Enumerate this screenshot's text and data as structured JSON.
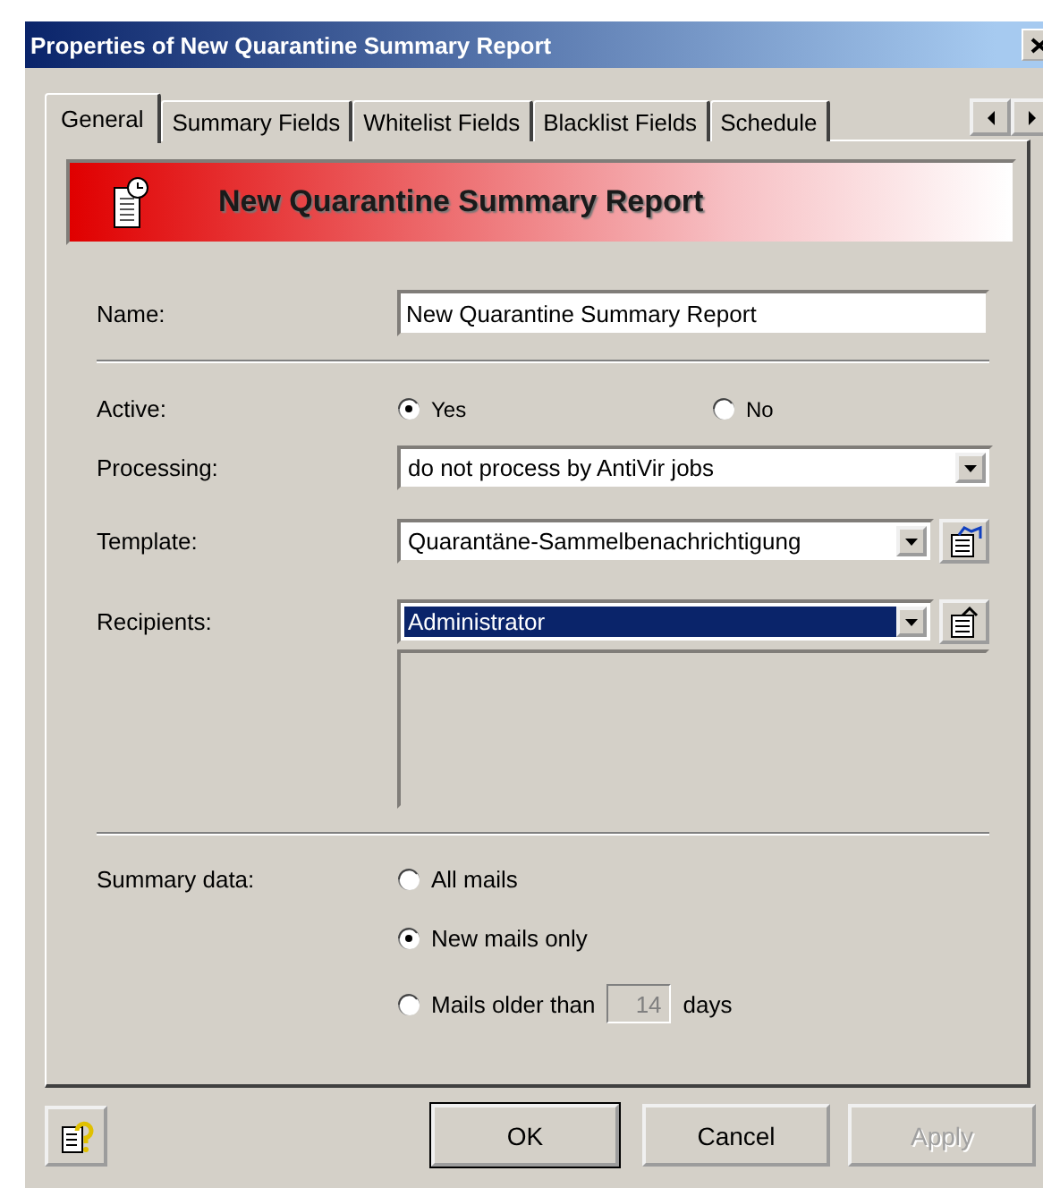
{
  "window": {
    "title": "Properties of New Quarantine Summary Report"
  },
  "tabs": [
    {
      "label": "General",
      "selected": true
    },
    {
      "label": "Summary Fields",
      "selected": false
    },
    {
      "label": "Whitelist Fields",
      "selected": false
    },
    {
      "label": "Blacklist Fields",
      "selected": false
    },
    {
      "label": "Schedule",
      "selected": false
    }
  ],
  "banner": {
    "title": "New Quarantine Summary Report"
  },
  "form": {
    "name": {
      "label": "Name:",
      "value": "New Quarantine Summary Report"
    },
    "active": {
      "label": "Active:",
      "options": [
        {
          "label": "Yes",
          "selected": true
        },
        {
          "label": "No",
          "selected": false
        }
      ]
    },
    "processing": {
      "label": "Processing:",
      "value": "do not process by AntiVir jobs"
    },
    "template": {
      "label": "Template:",
      "value": "Quarantäne-Sammelbenachrichtigung"
    },
    "recipients": {
      "label": "Recipients:",
      "value": "Administrator",
      "selected": true
    },
    "summary_data": {
      "label": "Summary data:",
      "options": [
        {
          "label": "All mails",
          "selected": false
        },
        {
          "label": "New mails only",
          "selected": true
        },
        {
          "label": "Mails older than",
          "selected": false,
          "days": {
            "value": "14",
            "disabled": true,
            "unit": "days"
          }
        }
      ]
    }
  },
  "buttons": [
    {
      "label": "OK",
      "default": true,
      "disabled": false
    },
    {
      "label": "Cancel",
      "default": false,
      "disabled": false
    },
    {
      "label": "Apply",
      "default": false,
      "disabled": true
    }
  ]
}
